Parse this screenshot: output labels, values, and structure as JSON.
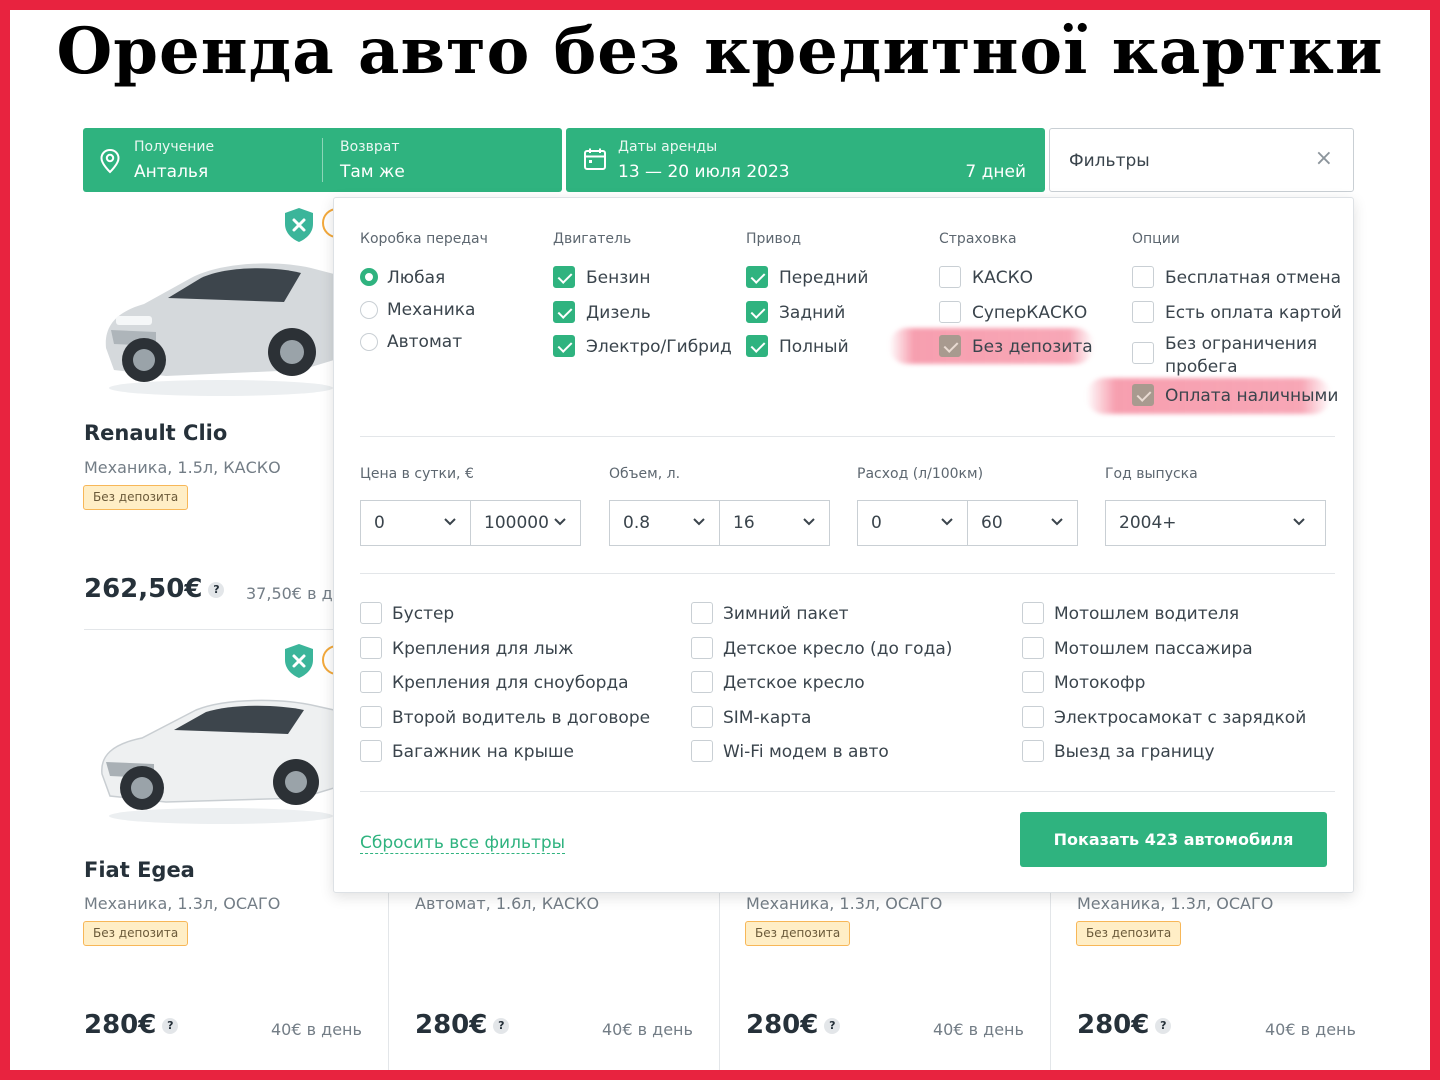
{
  "headline": "Оренда авто без кредитної картки",
  "search": {
    "pickup_label": "Получение",
    "pickup_value": "Анталья",
    "return_label": "Возврат",
    "return_value": "Там же",
    "dates_label": "Даты аренды",
    "dates_value": "13 — 20 июля 2023",
    "duration": "7 дней",
    "filters_label": "Фильтры",
    "filters_close": "×"
  },
  "filters": {
    "transmission": {
      "title": "Коробка передач",
      "options": [
        {
          "label": "Любая",
          "selected": true
        },
        {
          "label": "Механика",
          "selected": false
        },
        {
          "label": "Автомат",
          "selected": false
        }
      ]
    },
    "engine": {
      "title": "Двигатель",
      "options": [
        {
          "label": "Бензин",
          "checked": true
        },
        {
          "label": "Дизель",
          "checked": true
        },
        {
          "label": "Электро/Гибрид",
          "checked": true
        }
      ]
    },
    "drive": {
      "title": "Привод",
      "options": [
        {
          "label": "Передний",
          "checked": true
        },
        {
          "label": "Задний",
          "checked": true
        },
        {
          "label": "Полный",
          "checked": true
        }
      ]
    },
    "insurance": {
      "title": "Страховка",
      "options": [
        {
          "label": "КАСКО",
          "checked": false
        },
        {
          "label": "СуперКАСКО",
          "checked": false
        },
        {
          "label": "Без депозита",
          "checked": true
        }
      ]
    },
    "options": {
      "title": "Опции",
      "options": [
        {
          "label": "Бесплатная отмена",
          "checked": false
        },
        {
          "label": "Есть оплата картой",
          "checked": false
        },
        {
          "label": "Без ограничения пробега",
          "checked": false
        },
        {
          "label": "Оплата наличными",
          "checked": true
        }
      ]
    },
    "ranges": {
      "price": {
        "label": "Цена в сутки, €",
        "min": "0",
        "max": "100000"
      },
      "volume": {
        "label": "Объем, л.",
        "min": "0.8",
        "max": "16"
      },
      "consumption": {
        "label": "Расход (л/100км)",
        "min": "0",
        "max": "60"
      },
      "year": {
        "label": "Год выпуска",
        "value": "2004+"
      }
    },
    "extras": [
      [
        "Бустер",
        "Крепления для лыж",
        "Крепления для сноуборда",
        "Второй водитель в договоре",
        "Багажник на крыше"
      ],
      [
        "Зимний пакет",
        "Детское кресло (до года)",
        "Детское кресло",
        "SIM-карта",
        "Wi-Fi модем в авто"
      ],
      [
        "Мотошлем водителя",
        "Мотошлем пассажира",
        "Мотокофр",
        "Электросамокат с зарядкой",
        "Выезд за границу"
      ]
    ],
    "reset_label": "Сбросить все фильтры",
    "show_label": "Показать 423 автомобиля"
  },
  "cars": {
    "card1": {
      "name": "Renault Clio",
      "spec": "Механика, 1.5л, КАСКО",
      "badge": "Без депозита",
      "price": "262,50€",
      "per_day": "37,50€ в д"
    },
    "card2": {
      "name": "Fiat Egea",
      "spec": "Механика, 1.3л, ОСАГО",
      "badge": "Без депозита",
      "price": "280€",
      "per_day": "40€ в день"
    },
    "card3": {
      "spec": "Автомат, 1.6л, КАСКО",
      "price": "280€",
      "per_day": "40€ в день"
    },
    "card4": {
      "spec": "Механика, 1.3л, ОСАГО",
      "badge": "Без депозита",
      "price": "280€",
      "per_day": "40€ в день"
    },
    "card5": {
      "spec": "Механика, 1.3л, ОСАГО",
      "badge": "Без депозита",
      "price": "280€",
      "per_day": "40€ в день"
    }
  },
  "price_help": "?",
  "colors": {
    "brand_green": "#2fb37f",
    "frame_red": "#e8233f",
    "badge_bg": "#ffeec6",
    "badge_border": "#f7b758"
  }
}
